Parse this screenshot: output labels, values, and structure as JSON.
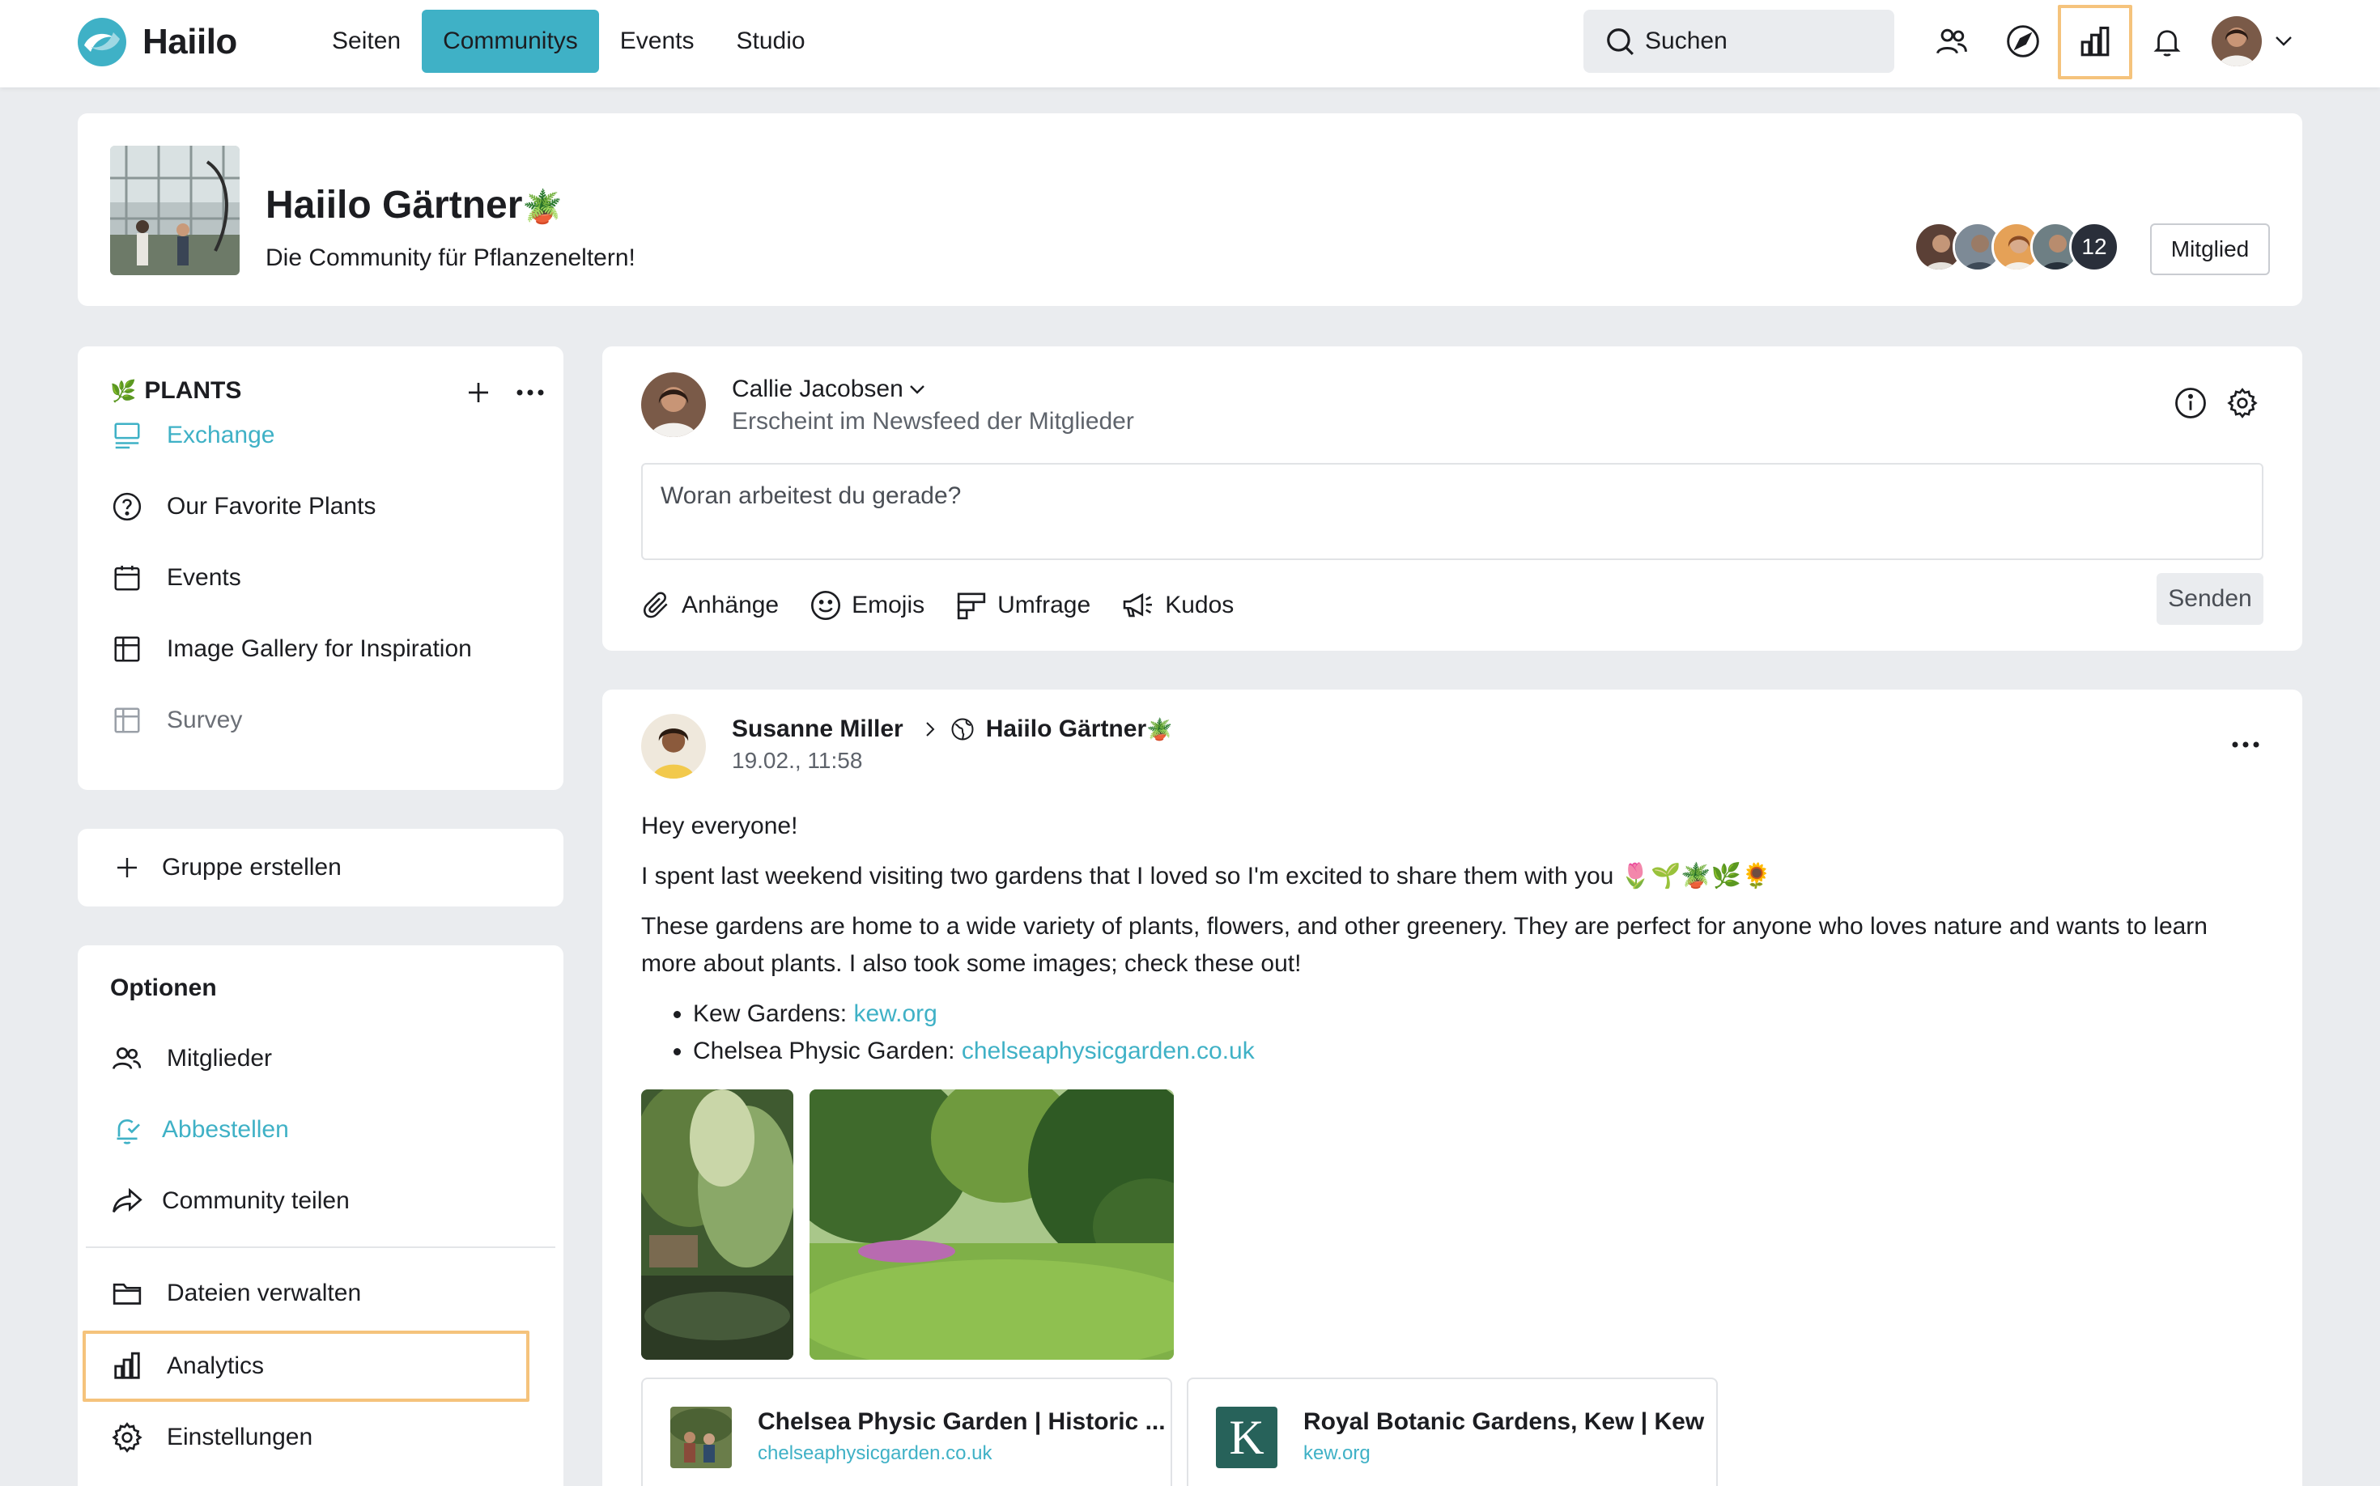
{
  "brand": {
    "name": "Haiilo",
    "accent": "#3fb1c6",
    "highlight": "#f5c37c"
  },
  "nav": {
    "items": [
      {
        "label": "Seiten"
      },
      {
        "label": "Communitys",
        "active": true
      },
      {
        "label": "Events"
      },
      {
        "label": "Studio"
      }
    ]
  },
  "search": {
    "label": "Suchen"
  },
  "topbar_icons": [
    "people-icon",
    "compass-icon",
    "analytics-icon",
    "bell-icon",
    "avatar",
    "chevron-down-icon"
  ],
  "community": {
    "title": "Haiilo Gärtner",
    "title_emoji": "🪴",
    "subtitle": "Die Community für Pflanzeneltern!",
    "member_count": "12",
    "member_button": "Mitglied"
  },
  "sidebar": {
    "plants": {
      "heading": "PLANTS",
      "heading_emoji": "🌿",
      "items": [
        {
          "label": "Exchange",
          "icon": "board-icon",
          "state": "active"
        },
        {
          "label": "Our Favorite Plants",
          "icon": "question-circle-icon"
        },
        {
          "label": "Events",
          "icon": "calendar-icon"
        },
        {
          "label": "Image Gallery for Inspiration",
          "icon": "table-icon"
        },
        {
          "label": "Survey",
          "icon": "table-icon",
          "state": "muted"
        }
      ]
    },
    "create_group": "Gruppe erstellen",
    "options": {
      "title": "Optionen",
      "items": [
        {
          "label": "Mitglieder",
          "icon": "members-icon"
        },
        {
          "label": "Abbestellen",
          "icon": "bell-check-icon",
          "state": "active"
        },
        {
          "label": "Community teilen",
          "icon": "share-icon"
        },
        {
          "label": "Dateien verwalten",
          "icon": "folder-icon"
        },
        {
          "label": "Analytics",
          "icon": "analytics-icon",
          "highlighted": true
        },
        {
          "label": "Einstellungen",
          "icon": "gear-icon"
        }
      ]
    }
  },
  "composer": {
    "author": "Callie Jacobsen",
    "audience": "Erscheint im Newsfeed der Mitglieder",
    "placeholder": "Woran arbeitest du gerade?",
    "tools": [
      {
        "label": "Anhänge",
        "icon": "paperclip-icon"
      },
      {
        "label": "Emojis",
        "icon": "smiley-icon"
      },
      {
        "label": "Umfrage",
        "icon": "poll-icon"
      },
      {
        "label": "Kudos",
        "icon": "megaphone-icon"
      }
    ],
    "send": "Senden"
  },
  "post": {
    "author": "Susanne Miller",
    "target": "Haiilo Gärtner",
    "target_emoji": "🪴",
    "date": "19.02., 11:58",
    "paragraphs": [
      "Hey everyone!",
      "I spent last weekend visiting two gardens that I loved so I'm excited to share them with you 🌷🌱🪴🌿🌻",
      "These gardens are home to a wide variety of plants, flowers, and other greenery. They are perfect for anyone who loves nature and wants to learn more about plants. I also took some images; check these out!"
    ],
    "list": [
      {
        "prefix": "Kew Gardens: ",
        "link": "kew.org"
      },
      {
        "prefix": "Chelsea Physic Garden: ",
        "link": "chelseaphysicgarden.co.uk"
      }
    ],
    "link_previews": [
      {
        "title": "Chelsea Physic Garden | Historic ...",
        "url": "chelseaphysicgarden.co.uk"
      },
      {
        "title": "Royal Botanic Gardens, Kew | Kew",
        "url": "kew.org",
        "thumb_letter": "K"
      }
    ]
  }
}
